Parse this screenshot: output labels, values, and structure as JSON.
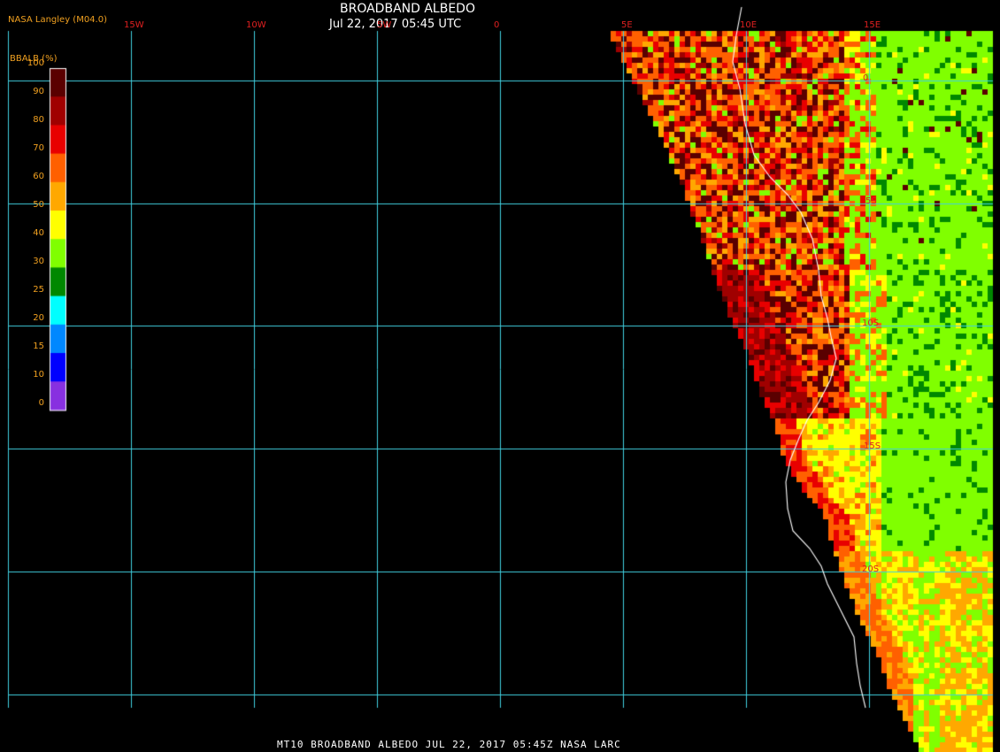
{
  "header": {
    "org_label": "NASA Langley (M04.0)",
    "title": "BROADBAND ALBEDO",
    "datetime": "Jul 22, 2017 05:45 UTC"
  },
  "colorbar": {
    "label": "BBALB (%)",
    "ticks": [
      "100",
      "90",
      "80",
      "70",
      "60",
      "50",
      "40",
      "30",
      "25",
      "20",
      "15",
      "10",
      "0"
    ],
    "colors": [
      "#5a0000",
      "#a00000",
      "#e80000",
      "#ff6000",
      "#ffa800",
      "#ffff00",
      "#80ff00",
      "#008800",
      "#00ffff",
      "#0088ff",
      "#0000ff",
      "#8830e0"
    ]
  },
  "map": {
    "longitude_labels": [
      "15W",
      "10W",
      "5W",
      "0",
      "5E",
      "10E",
      "15E"
    ],
    "latitude_labels": [
      "0",
      "5S",
      "10S",
      "15S",
      "20S"
    ],
    "grid_color": "#40d0e0",
    "coastline_color": "#ffffff"
  },
  "footer": {
    "text": "MT10  BROADBAND ALBEDO   JUL 22, 2017 05:45Z   NASA LARC"
  }
}
